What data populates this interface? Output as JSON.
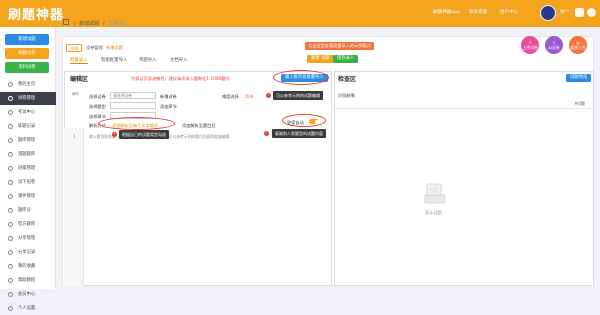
{
  "app": {
    "logo": "刷题神器"
  },
  "topbar": {
    "items": [
      "刷题神器app",
      "联系客服",
      "用户中心"
    ],
    "username": "张**"
  },
  "sidebar": {
    "buttons": [
      {
        "label": "新建试题",
        "color": "#2b8be6"
      },
      {
        "label": "刷题试卷",
        "color": "#f4a31c"
      },
      {
        "label": "资料试卷",
        "color": "#3ab24a"
      }
    ],
    "items": [
      "我的主页",
      "试卷管理",
      "考试中心",
      "练题记录",
      "题库管理",
      "错题题库",
      "班级管理",
      "试下组卷",
      "课件管理",
      "题库分",
      "官方题库",
      "分享管理",
      "分享记录",
      "我的收藏",
      "帮助教程",
      "会员中心",
      "个人设置"
    ],
    "active_index": 1
  },
  "breadcrumb": {
    "items": [
      "新增试题",
      "批量录入"
    ]
  },
  "header": {
    "tags": [
      "试卷",
      "试卷管理",
      "新增试题"
    ],
    "tabs": [
      "批量录入",
      "智能批量导入",
      "单题导入",
      "文档导入"
    ],
    "save_button": "新建 试题",
    "save_label": "保存录入",
    "orange_notice": "点击这里查看批量录入的示例格式",
    "quick_buttons": [
      {
        "label": "上传试卷",
        "color": "#e84e9d"
      },
      {
        "label": "AI试卷",
        "color": "#9b59d6"
      },
      {
        "label": "批量上传",
        "color": "#f4743b"
      }
    ]
  },
  "edit_panel": {
    "title": "编辑区",
    "notice": "为保证页面流畅性，建议每次录入题数在1-1000题内",
    "import_button": "输入框内容批量导入",
    "form": {
      "type_label": "选择试卷",
      "type_value": "请选择试卷",
      "new_label": "新增试卷",
      "kind_label": "选择题型",
      "kind_value": "",
      "section_label": "选择章节",
      "difficulty_label": "难度选择",
      "difficulty_value": "简单",
      "chapter_label": "添加章节",
      "note_label": "解析方式",
      "note_value": "添加解析至每个文本格式",
      "note_value2": "添加解析至题目后",
      "toggle_label": "答案自动"
    },
    "line_number": "1",
    "editor_placeholder": "输入题目和答案，请按照格式输入题目和答案，可以参考示例的题目内容的批量编辑"
  },
  "check_panel": {
    "title": "检查区",
    "result_label": "识别结果:",
    "count_label": "共0题",
    "check_button": "试题预览",
    "empty_text": "暂无试题"
  },
  "callouts": {
    "c1": "可以参考示例的试题编辑",
    "c2": "根据自己的试题类型勾选",
    "c3": "复制别人家题型的试题内容"
  }
}
